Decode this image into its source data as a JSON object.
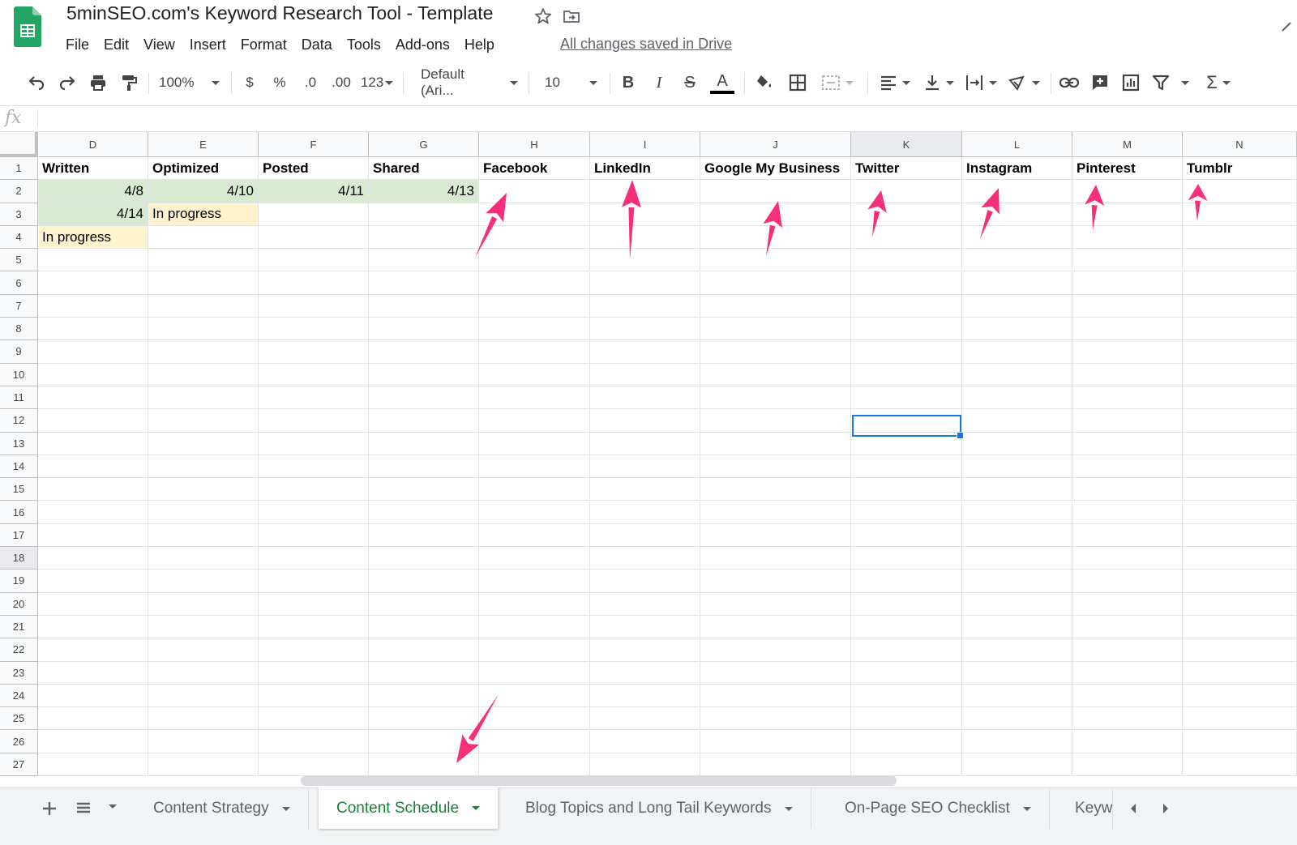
{
  "document": {
    "title": "5minSEO.com's Keyword Research Tool - Template",
    "save_status": "All changes saved in Drive"
  },
  "menu": [
    "File",
    "Edit",
    "View",
    "Insert",
    "Format",
    "Data",
    "Tools",
    "Add-ons",
    "Help"
  ],
  "toolbar": {
    "zoom": "100%",
    "currency": "$",
    "percent": "%",
    "decrease_decimal": ".0",
    "increase_decimal": ".00",
    "more_formats": "123",
    "font": "Default (Ari...",
    "font_size": "10",
    "bold": "B",
    "italic": "I",
    "strikethrough": "S",
    "text_color": "A",
    "sum": "Σ"
  },
  "formula_bar": {
    "fx_label": "fx",
    "value": ""
  },
  "grid": {
    "columns": [
      "D",
      "E",
      "F",
      "G",
      "H",
      "I",
      "J",
      "K",
      "L",
      "M",
      "N"
    ],
    "active_column": "K",
    "rows": [
      "1",
      "2",
      "3",
      "4",
      "5",
      "6",
      "7",
      "8",
      "9",
      "10",
      "11",
      "12",
      "13",
      "14",
      "15",
      "16",
      "17",
      "18",
      "19",
      "20",
      "21",
      "22",
      "23",
      "24",
      "25",
      "26",
      "27"
    ],
    "active_row": "18",
    "headers_row1": [
      "Written",
      "Optimized",
      "Posted",
      "Shared",
      "Facebook",
      "LinkedIn",
      "Google My Business",
      "Twitter",
      "Instagram",
      "Pinterest",
      "Tumblr"
    ],
    "row2": [
      "4/8",
      "4/10",
      "4/11",
      "4/13",
      "",
      "",
      "",
      "",
      "",
      "",
      ""
    ],
    "row3": [
      "4/14",
      "In progress",
      "",
      "",
      "",
      "",
      "",
      "",
      "",
      "",
      ""
    ],
    "row4": [
      "In progress",
      "",
      "",
      "",
      "",
      "",
      "",
      "",
      "",
      "",
      ""
    ],
    "colors": {
      "done": "#d9ead3",
      "in_progress": "#fff2cc",
      "selection": "#1a73e8",
      "annotation_arrow": "#f72f7b"
    }
  },
  "sheets": {
    "tabs": [
      "Content Strategy",
      "Content Schedule",
      "Blog Topics and Long Tail Keywords",
      "On-Page SEO Checklist",
      "Keyw"
    ],
    "active": "Content Schedule"
  }
}
